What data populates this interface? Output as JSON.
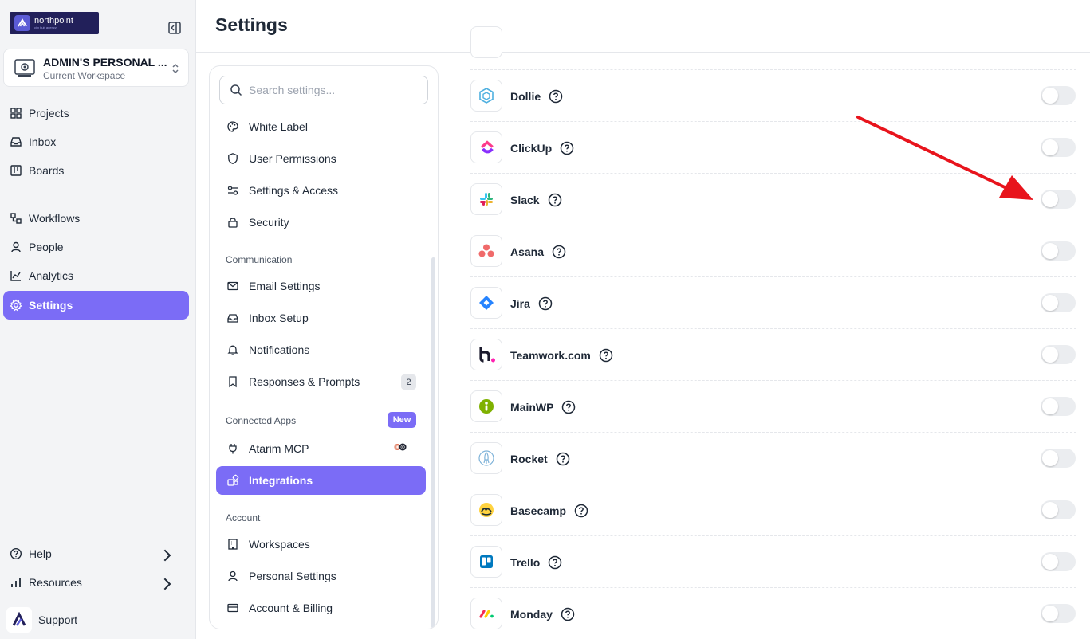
{
  "brand": {
    "name": "northpoint",
    "tagline": "city hub agency"
  },
  "workspace": {
    "name": "ADMIN'S PERSONAL ...",
    "subtitle": "Current Workspace"
  },
  "sidebar": {
    "items": [
      {
        "label": "Projects",
        "icon": "grid-icon"
      },
      {
        "label": "Inbox",
        "icon": "inbox-icon"
      },
      {
        "label": "Boards",
        "icon": "board-icon"
      },
      {
        "label": "Workflows",
        "icon": "workflow-icon"
      },
      {
        "label": "People",
        "icon": "user-icon"
      },
      {
        "label": "Analytics",
        "icon": "analytics-icon"
      },
      {
        "label": "Settings",
        "icon": "gear-icon",
        "active": true
      }
    ],
    "bottom": [
      {
        "label": "Help",
        "icon": "help-icon"
      },
      {
        "label": "Resources",
        "icon": "bars-icon"
      }
    ],
    "support_label": "Support"
  },
  "header": {
    "title": "Settings"
  },
  "settings_menu": {
    "search_placeholder": "Search settings...",
    "items_general": [
      "White Label",
      "User Permissions",
      "Settings & Access",
      "Security"
    ],
    "section_communication": "Communication",
    "items_communication": [
      "Email Settings",
      "Inbox Setup",
      "Notifications",
      "Responses & Prompts"
    ],
    "responses_count": "2",
    "section_connected": "Connected Apps",
    "new_badge": "New",
    "items_connected": [
      "Atarim MCP",
      "Integrations"
    ],
    "section_account": "Account",
    "items_account": [
      "Workspaces",
      "Personal Settings",
      "Account & Billing"
    ]
  },
  "integrations": [
    {
      "name": "Dollie",
      "enabled": false
    },
    {
      "name": "ClickUp",
      "enabled": false
    },
    {
      "name": "Slack",
      "enabled": false
    },
    {
      "name": "Asana",
      "enabled": false
    },
    {
      "name": "Jira",
      "enabled": false
    },
    {
      "name": "Teamwork.com",
      "enabled": false
    },
    {
      "name": "MainWP",
      "enabled": false
    },
    {
      "name": "Rocket",
      "enabled": false
    },
    {
      "name": "Basecamp",
      "enabled": false
    },
    {
      "name": "Trello",
      "enabled": false
    },
    {
      "name": "Monday",
      "enabled": false
    }
  ],
  "colors": {
    "accent": "#7b6cf6",
    "annotation_arrow": "#e8141c"
  }
}
